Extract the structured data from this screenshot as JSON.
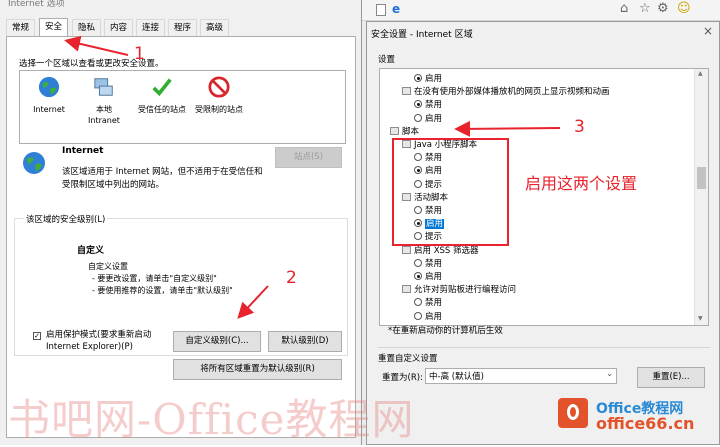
{
  "internet_options": {
    "title": "Internet 选项",
    "tabs": [
      "常规",
      "安全",
      "隐私",
      "内容",
      "连接",
      "程序",
      "高级"
    ],
    "active_tab": 1,
    "zone_prompt": "选择一个区域以查看或更改安全设置。",
    "zones": [
      {
        "label": "Internet",
        "icon": "globe-icon"
      },
      {
        "label": "本地\nIntranet",
        "icon": "intranet-icon"
      },
      {
        "label": "受信任的站点",
        "icon": "check-icon"
      },
      {
        "label": "受限制的站点",
        "icon": "no-entry-icon"
      }
    ],
    "zone_title": "Internet",
    "zone_desc": "该区域适用于 Internet 网站，但不适用于在受信任和受限制区域中列出的网站。",
    "sites_button": "站点(S)",
    "security_level_title": "该区域的安全级别(L)",
    "custom_title": "自定义",
    "custom_lines": [
      "自定义设置",
      "- 要更改设置，请单击\"自定义级别\"",
      "- 要使用推荐的设置，请单击\"默认级别\""
    ],
    "protected_mode_label": "启用保护模式(要求重新启动\nInternet Explorer)(P)",
    "protected_mode_checked": true,
    "custom_level_button": "自定义级别(C)...",
    "default_level_button": "默认级别(D)",
    "reset_all_button": "将所有区域重置为默认级别(R)"
  },
  "security_settings": {
    "title": "安全设置 - Internet 区域",
    "close_label": "×",
    "settings_label": "设置",
    "items": [
      {
        "type": "radio",
        "label": "启用",
        "checked": true,
        "indent": 2
      },
      {
        "type": "setting",
        "label": "在没有使用外部媒体播放机的网页上显示视频和动画",
        "indent": 1
      },
      {
        "type": "radio",
        "label": "禁用",
        "checked": true,
        "indent": 2
      },
      {
        "type": "radio",
        "label": "启用",
        "checked": false,
        "indent": 2
      },
      {
        "type": "group",
        "label": "脚本",
        "indent": 0
      },
      {
        "type": "setting",
        "label": "Java 小程序脚本",
        "indent": 1
      },
      {
        "type": "radio",
        "label": "禁用",
        "checked": false,
        "indent": 2
      },
      {
        "type": "radio",
        "label": "启用",
        "checked": true,
        "indent": 2
      },
      {
        "type": "radio",
        "label": "提示",
        "checked": false,
        "indent": 2
      },
      {
        "type": "setting",
        "label": "活动脚本",
        "indent": 1
      },
      {
        "type": "radio",
        "label": "禁用",
        "checked": false,
        "indent": 2
      },
      {
        "type": "radio",
        "label": "启用",
        "checked": true,
        "indent": 2,
        "selected": true
      },
      {
        "type": "radio",
        "label": "提示",
        "checked": false,
        "indent": 2
      },
      {
        "type": "setting",
        "label": "启用 XSS 筛选器",
        "indent": 1
      },
      {
        "type": "radio",
        "label": "禁用",
        "checked": false,
        "indent": 2
      },
      {
        "type": "radio",
        "label": "启用",
        "checked": true,
        "indent": 2
      },
      {
        "type": "setting",
        "label": "允许对剪贴板进行编程访问",
        "indent": 1
      },
      {
        "type": "radio",
        "label": "禁用",
        "checked": false,
        "indent": 2
      },
      {
        "type": "radio",
        "label": "启用",
        "checked": false,
        "indent": 2
      }
    ],
    "restart_note": "*在重新启动你的计算机后生效",
    "reset_section_title": "重置自定义设置",
    "reset_to_label": "重置为(R):",
    "reset_to_value": "中-高 (默认值)",
    "reset_button": "重置(E)..."
  },
  "annotations": {
    "num1": "1",
    "num2": "2",
    "num3": "3",
    "note": "启用这两个设置",
    "color": "#e8232d"
  },
  "watermarks": {
    "center": "书吧网-Office教程网",
    "logo_text": "Office教程网",
    "logo_url": "office66.cn"
  }
}
